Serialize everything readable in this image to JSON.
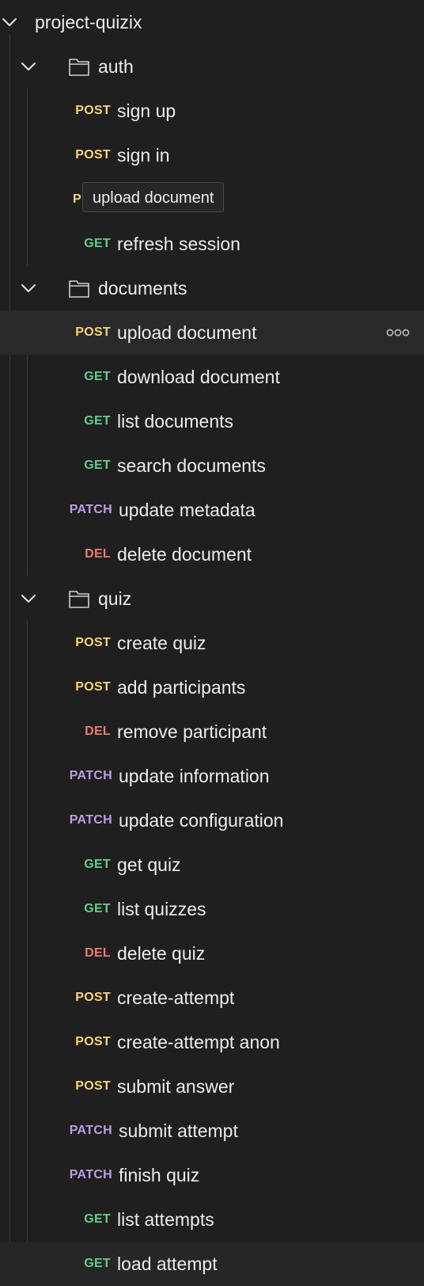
{
  "tree": {
    "root": {
      "label": "project-quizix",
      "expanded": true
    },
    "folders": [
      {
        "name": "auth",
        "expanded": true,
        "requests": [
          {
            "method": "POST",
            "label": "sign up"
          },
          {
            "method": "POST",
            "label": "sign in"
          },
          {
            "method": "POST",
            "method_display": "P",
            "label": ""
          },
          {
            "method": "GET",
            "label": "refresh session"
          }
        ]
      },
      {
        "name": "documents",
        "expanded": true,
        "requests": [
          {
            "method": "POST",
            "label": "upload document",
            "hovered": true
          },
          {
            "method": "GET",
            "label": "download document"
          },
          {
            "method": "GET",
            "label": "list documents"
          },
          {
            "method": "GET",
            "label": "search documents"
          },
          {
            "method": "PATCH",
            "label": "update metadata"
          },
          {
            "method": "DEL",
            "label": "delete document"
          }
        ]
      },
      {
        "name": "quiz",
        "expanded": true,
        "requests": [
          {
            "method": "POST",
            "label": "create quiz"
          },
          {
            "method": "POST",
            "label": "add participants"
          },
          {
            "method": "DEL",
            "label": "remove participant"
          },
          {
            "method": "PATCH",
            "label": "update information"
          },
          {
            "method": "PATCH",
            "label": "update configuration"
          },
          {
            "method": "GET",
            "label": "get quiz"
          },
          {
            "method": "GET",
            "label": "list quizzes"
          },
          {
            "method": "DEL",
            "label": "delete quiz"
          },
          {
            "method": "POST",
            "label": "create-attempt"
          },
          {
            "method": "POST",
            "label": "create-attempt anon"
          },
          {
            "method": "POST",
            "label": "submit answer"
          },
          {
            "method": "PATCH",
            "label": "submit attempt"
          },
          {
            "method": "PATCH",
            "label": "finish quiz"
          },
          {
            "method": "GET",
            "label": "list attempts"
          },
          {
            "method": "GET",
            "label": "load attempt",
            "selected": true
          }
        ]
      }
    ],
    "tooltip": {
      "text": "upload document"
    },
    "icons": {
      "chevron": "chevron-down-icon",
      "folder": "folder-icon",
      "more": "more-options-icon"
    },
    "colors": {
      "background": "#1f1f1f",
      "post": "#f7d56e",
      "get": "#5fcf8d",
      "del": "#ec7a72",
      "patch": "#b99ee6",
      "text": "#ececec"
    }
  }
}
